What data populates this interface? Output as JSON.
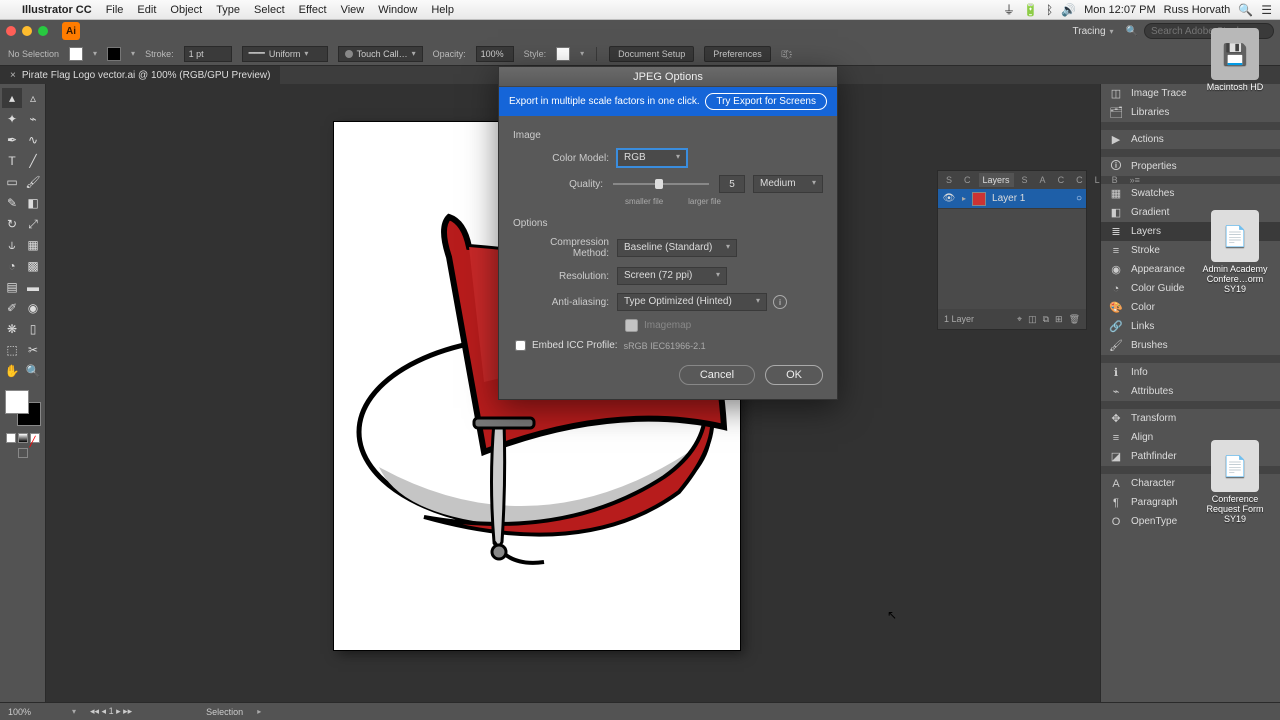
{
  "mac_menu": {
    "app": "Illustrator CC",
    "items": [
      "File",
      "Edit",
      "Object",
      "Type",
      "Select",
      "Effect",
      "View",
      "Window",
      "Help"
    ],
    "clock": "Mon 12:07 PM",
    "user": "Russ Horvath"
  },
  "top_bar": {
    "workspace": "Tracing",
    "stock_placeholder": "Search Adobe Stock"
  },
  "control_bar": {
    "no_selection": "No Selection",
    "stroke_label": "Stroke:",
    "stroke_value": "1 pt",
    "stroke_profile": "Uniform",
    "brush_label": "Touch Call…",
    "opacity_label": "Opacity:",
    "opacity_value": "100%",
    "style_label": "Style:",
    "doc_setup": "Document Setup",
    "preferences": "Preferences"
  },
  "doc_tab": "Pirate Flag Logo vector.ai @ 100% (RGB/GPU Preview)",
  "panels": [
    "Image Trace",
    "Libraries",
    "Actions",
    "Properties",
    "Swatches",
    "Gradient",
    "Layers",
    "Stroke",
    "Appearance",
    "Color Guide",
    "Color",
    "Links",
    "Brushes",
    "Info",
    "Attributes",
    "Transform",
    "Align",
    "Pathfinder",
    "Character",
    "Paragraph",
    "OpenType"
  ],
  "panels_active_index": 6,
  "layers": {
    "tabs": [
      "S",
      "C",
      "Layers",
      "S",
      "A",
      "C",
      "C",
      "L",
      "B"
    ],
    "items": [
      {
        "name": "Layer 1",
        "color": "#c33"
      }
    ],
    "footer": "1 Layer"
  },
  "desktop": {
    "hd": "Macintosh HD",
    "doc1": "Admin Academy Confere…orm SY19",
    "doc2": "Conference Request Form SY19"
  },
  "dialog": {
    "title": "JPEG Options",
    "banner_text": "Export in multiple scale factors in one click.",
    "banner_button": "Try Export for Screens",
    "section_image": "Image",
    "color_model_label": "Color Model:",
    "color_model_value": "RGB",
    "quality_label": "Quality:",
    "quality_value": "5",
    "quality_preset": "Medium",
    "quality_small": "smaller file",
    "quality_large": "larger file",
    "section_options": "Options",
    "compression_label": "Compression Method:",
    "compression_value": "Baseline (Standard)",
    "resolution_label": "Resolution:",
    "resolution_value": "Screen (72 ppi)",
    "aa_label": "Anti-aliasing:",
    "aa_value": "Type Optimized (Hinted)",
    "imagemap": "Imagemap",
    "embed_icc_label": "Embed ICC Profile:",
    "embed_icc_detail": "sRGB IEC61966-2.1",
    "cancel": "Cancel",
    "ok": "OK"
  },
  "status": {
    "zoom": "100%",
    "page": "1",
    "tool": "Selection"
  }
}
